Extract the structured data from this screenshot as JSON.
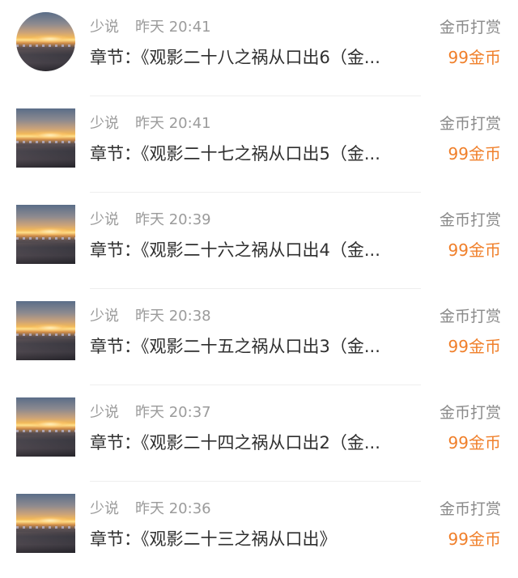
{
  "items": [
    {
      "user": "少说",
      "time": "昨天 20:41",
      "reward_label": "金币打赏",
      "title": "章节：《观影二十八之祸从口出6（金...",
      "amount": "99金币"
    },
    {
      "user": "少说",
      "time": "昨天 20:41",
      "reward_label": "金币打赏",
      "title": "章节：《观影二十七之祸从口出5（金...",
      "amount": "99金币"
    },
    {
      "user": "少说",
      "time": "昨天 20:39",
      "reward_label": "金币打赏",
      "title": "章节：《观影二十六之祸从口出4（金...",
      "amount": "99金币"
    },
    {
      "user": "少说",
      "time": "昨天 20:38",
      "reward_label": "金币打赏",
      "title": "章节：《观影二十五之祸从口出3（金...",
      "amount": "99金币"
    },
    {
      "user": "少说",
      "time": "昨天 20:37",
      "reward_label": "金币打赏",
      "title": "章节：《观影二十四之祸从口出2（金...",
      "amount": "99金币"
    },
    {
      "user": "少说",
      "time": "昨天 20:36",
      "reward_label": "金币打赏",
      "title": "章节：《观影二十三之祸从口出》",
      "amount": "99金币"
    }
  ]
}
